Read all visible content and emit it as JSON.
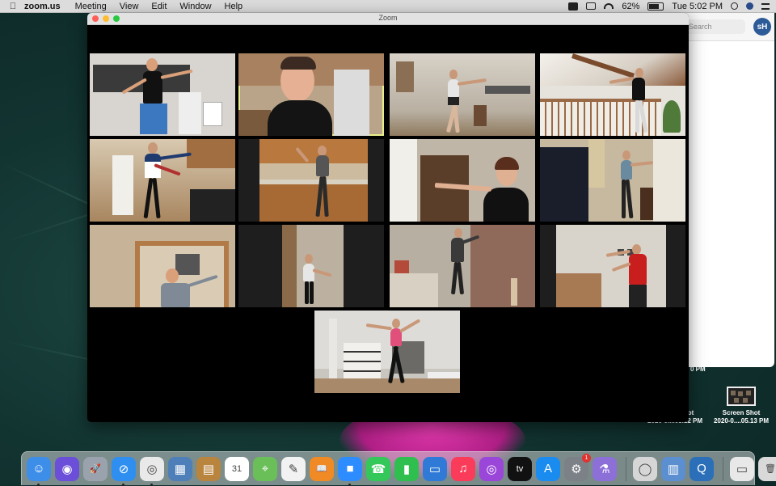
{
  "menubar": {
    "app_name": "zoom.us",
    "menus": [
      "Meeting",
      "View",
      "Edit",
      "Window",
      "Help"
    ],
    "battery": "62%",
    "clock": "Tue 5:02 PM"
  },
  "zoom_window": {
    "title": "Zoom",
    "participants": [
      {
        "id": 1,
        "active": false
      },
      {
        "id": 2,
        "active": true
      },
      {
        "id": 3,
        "active": false
      },
      {
        "id": 4,
        "active": false
      },
      {
        "id": 5,
        "active": false
      },
      {
        "id": 6,
        "active": false
      },
      {
        "id": 7,
        "active": false
      },
      {
        "id": 8,
        "active": false
      },
      {
        "id": 9,
        "active": false
      },
      {
        "id": 10,
        "active": false
      },
      {
        "id": 11,
        "active": false
      },
      {
        "id": 12,
        "active": false
      },
      {
        "id": 13,
        "active": false
      }
    ]
  },
  "background_window": {
    "search_placeholder": "Search",
    "profile_initials": "sH"
  },
  "desktop": {
    "partial_time": "0 PM",
    "files": [
      {
        "name": "Screen Shot",
        "date": "2020-0....03.12 PM"
      },
      {
        "name": "Screen Shot",
        "date": "2020-0....05.13 PM"
      }
    ]
  },
  "dock": {
    "items": [
      {
        "name": "finder-icon",
        "color": "#3d8ee8",
        "glyph": "☺",
        "running": true
      },
      {
        "name": "siri-icon",
        "color": "#6b4fd8",
        "glyph": "◉",
        "running": false
      },
      {
        "name": "launchpad-icon",
        "color": "#9aa3ad",
        "glyph": "🚀",
        "running": false
      },
      {
        "name": "safari-icon",
        "color": "#2f8ff0",
        "glyph": "⊘",
        "running": true
      },
      {
        "name": "chrome-icon",
        "color": "#e9e9e9",
        "glyph": "◎",
        "running": true
      },
      {
        "name": "preview-icon",
        "color": "#4f7fb8",
        "glyph": "▦",
        "running": false
      },
      {
        "name": "notes-book-icon",
        "color": "#b8843e",
        "glyph": "▤",
        "running": false
      },
      {
        "name": "calendar-icon",
        "color": "#ffffff",
        "glyph": "31",
        "running": false
      },
      {
        "name": "maps-icon",
        "color": "#6bbf59",
        "glyph": "⌖",
        "running": false
      },
      {
        "name": "textedit-icon",
        "color": "#f2f2f2",
        "glyph": "✎",
        "running": false
      },
      {
        "name": "books-icon",
        "color": "#f08a24",
        "glyph": "📖",
        "running": false
      },
      {
        "name": "zoom-icon",
        "color": "#2d8cff",
        "glyph": "■",
        "running": true
      },
      {
        "name": "facetime-icon",
        "color": "#34c759",
        "glyph": "☎",
        "running": false
      },
      {
        "name": "numbers-icon",
        "color": "#2fbf4f",
        "glyph": "▮",
        "running": false
      },
      {
        "name": "keynote-icon",
        "color": "#2f7ad6",
        "glyph": "▭",
        "running": false
      },
      {
        "name": "music-icon",
        "color": "#fa3c5a",
        "glyph": "♫",
        "running": false
      },
      {
        "name": "podcasts-icon",
        "color": "#9a46d8",
        "glyph": "◎",
        "running": false
      },
      {
        "name": "apple-tv-icon",
        "color": "#111111",
        "glyph": "tv",
        "running": false
      },
      {
        "name": "app-store-icon",
        "color": "#1a8cf0",
        "glyph": "A",
        "running": false
      },
      {
        "name": "system-preferences-icon",
        "color": "#7c8188",
        "glyph": "⚙",
        "running": false,
        "badge": "1"
      },
      {
        "name": "flask-app-icon",
        "color": "#8d6fd8",
        "glyph": "⚗",
        "running": false
      },
      {
        "name": "disk-utility-icon",
        "color": "#d6d6d6",
        "glyph": "◯",
        "running": false,
        "after_separator": true
      },
      {
        "name": "photos-folder-icon",
        "color": "#5b8fcf",
        "glyph": "▥",
        "running": false
      },
      {
        "name": "quicktime-icon",
        "color": "#2a6fb8",
        "glyph": "Q",
        "running": false
      },
      {
        "name": "downloads-stack-icon",
        "color": "#e8e8e8",
        "glyph": "▭",
        "running": false,
        "after_separator": true
      },
      {
        "name": "trash-icon",
        "color": "#d9d9d9",
        "glyph": "🗑",
        "running": false
      }
    ]
  }
}
